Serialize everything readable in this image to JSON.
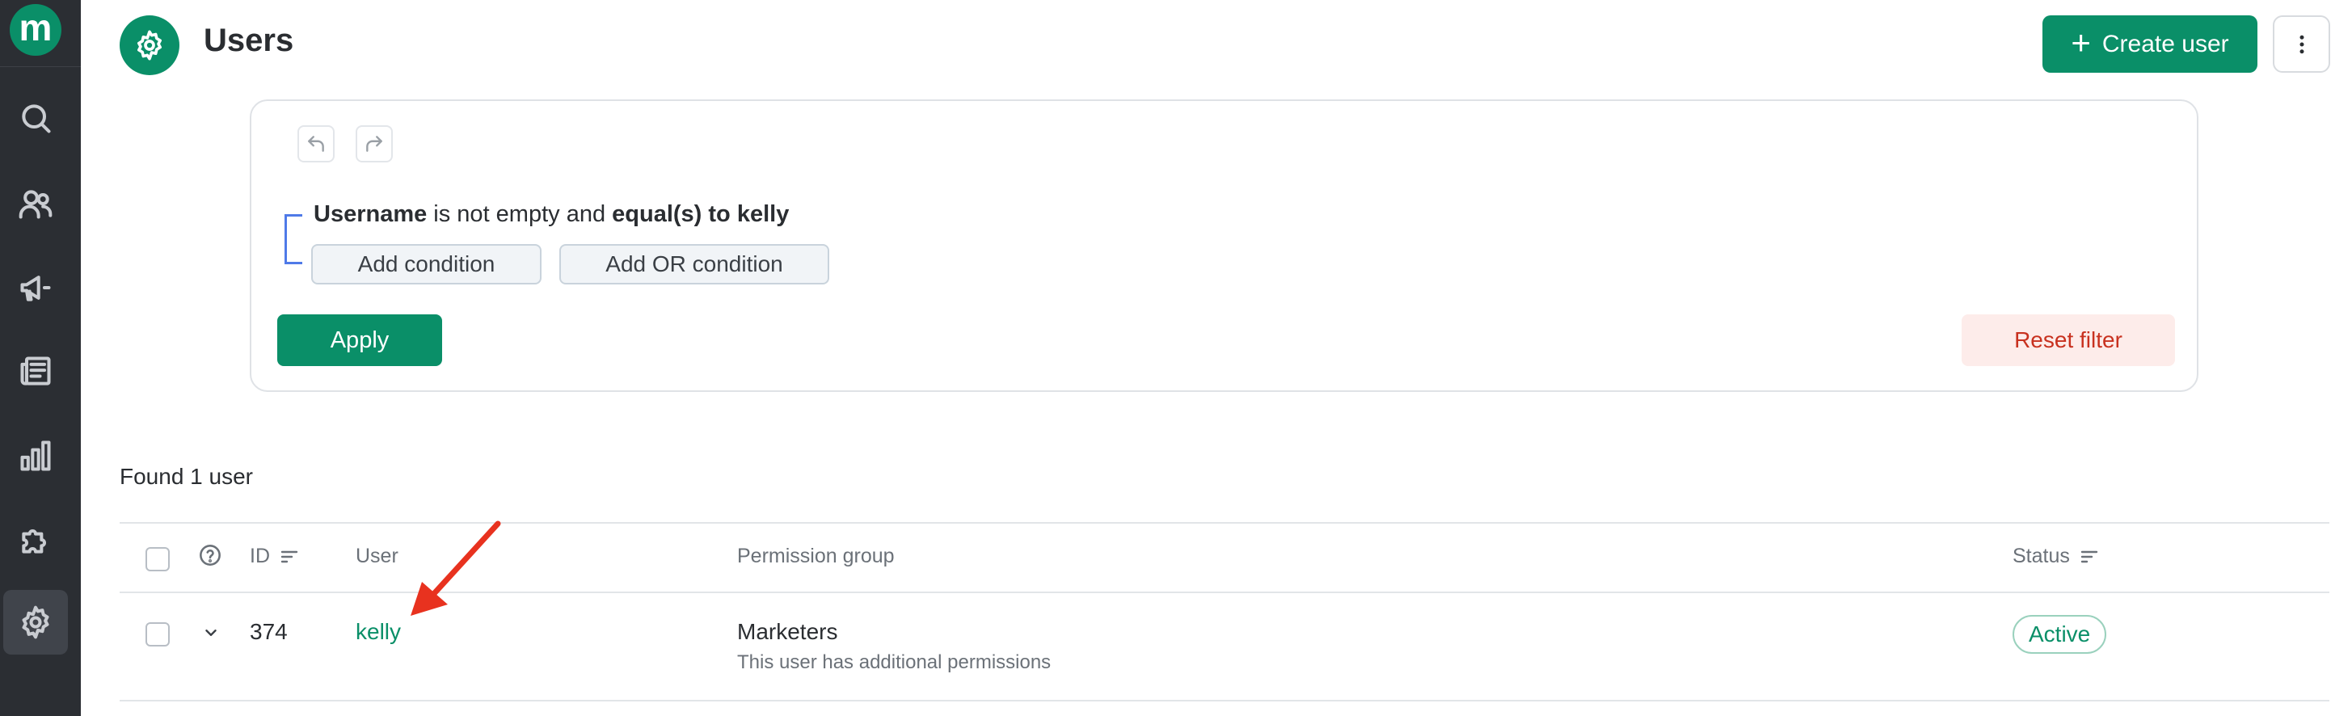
{
  "app": {
    "logo_letter": "m"
  },
  "sidebar": {
    "items": [
      {
        "name": "search",
        "icon": "search-icon"
      },
      {
        "name": "users",
        "icon": "users-icon"
      },
      {
        "name": "campaigns",
        "icon": "megaphone-icon"
      },
      {
        "name": "content",
        "icon": "newspaper-icon"
      },
      {
        "name": "reports",
        "icon": "bar-chart-icon"
      },
      {
        "name": "integrations",
        "icon": "puzzle-icon"
      },
      {
        "name": "settings",
        "icon": "gear-icon",
        "active": true
      }
    ]
  },
  "header": {
    "title": "Users",
    "icon": "gear-icon",
    "create_label": "Create user"
  },
  "filter": {
    "condition": {
      "field": "Username",
      "middle": " is not empty and ",
      "operator": "equal(s) to kelly"
    },
    "add_condition_label": "Add condition",
    "add_or_condition_label": "Add OR condition",
    "apply_label": "Apply",
    "reset_label": "Reset filter"
  },
  "results": {
    "found_text": "Found 1 user",
    "columns": {
      "id": "ID",
      "user": "User",
      "permission_group": "Permission group",
      "status": "Status"
    },
    "rows": [
      {
        "id": "374",
        "user": "kelly",
        "permission_group": "Marketers",
        "permission_note": "This user has additional permissions",
        "status": "Active"
      }
    ]
  },
  "colors": {
    "brand": "#0a8f68",
    "sidebar_bg": "#2b2e33",
    "danger": "#c8311f",
    "annotation_arrow": "#e8321f",
    "bracket": "#4f7ae8"
  }
}
